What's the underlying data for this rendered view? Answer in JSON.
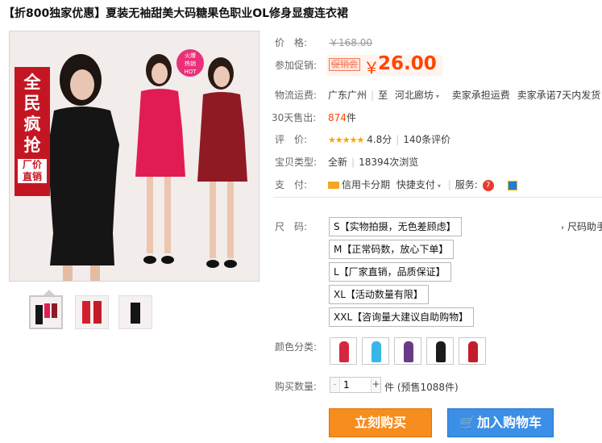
{
  "product": {
    "title": "【折800独家优惠】夏装无袖甜美大码糖果色职业OL修身显瘦连衣裙"
  },
  "image": {
    "promo_text": [
      "全",
      "民",
      "疯",
      "抢"
    ],
    "promo_small": [
      "厂价",
      "直销"
    ],
    "hot_badge": [
      "火爆",
      "热销",
      "HOT"
    ]
  },
  "price": {
    "label": "价　格:",
    "original": "￥168.00",
    "promo_label": "参加促销:",
    "promo_badge": "促销会",
    "currency": "￥",
    "value": "26.00"
  },
  "shipping": {
    "label": "物流运费:",
    "from": "广东广州",
    "to_word": "至",
    "to": "河北廊坊",
    "fee": "卖家承担运费",
    "promise": "卖家承诺7天内发货"
  },
  "sales": {
    "label": "30天售出:",
    "count": "874",
    "unit": "件"
  },
  "rating": {
    "label": "评　价:",
    "stars": "★★★★★",
    "score": "4.8分",
    "reviews": "140条评价"
  },
  "item_type": {
    "label": "宝贝类型:",
    "condition": "全新",
    "views": "18394次浏览"
  },
  "payment": {
    "label": "支　付:",
    "card": "信用卡分期",
    "express": "快捷支付",
    "service_label": "服务:"
  },
  "sizes": {
    "label": "尺　码:",
    "helper": "尺码助手",
    "options": [
      "S【实物拍摄，无色差顾虑】",
      "M【正常码数，放心下单】",
      "L【厂家直销，品质保证】",
      "XL【活动数量有限】",
      "XXL【咨询量大建议自助购物】"
    ]
  },
  "colors": {
    "label": "颜色分类:",
    "swatches": [
      "#d6273f",
      "#37b7e6",
      "#6a3a88",
      "#1b1b1b",
      "#c31d2b"
    ]
  },
  "quantity": {
    "label": "购买数量:",
    "value": "1",
    "minus": "-",
    "plus": "+",
    "unit_text": "件 (预售1088件)"
  },
  "actions": {
    "buy_now": "立刻购买",
    "add_to_cart": "加入购物车"
  },
  "thumbnails": [
    "thumb-1",
    "thumb-2",
    "thumb-3"
  ]
}
